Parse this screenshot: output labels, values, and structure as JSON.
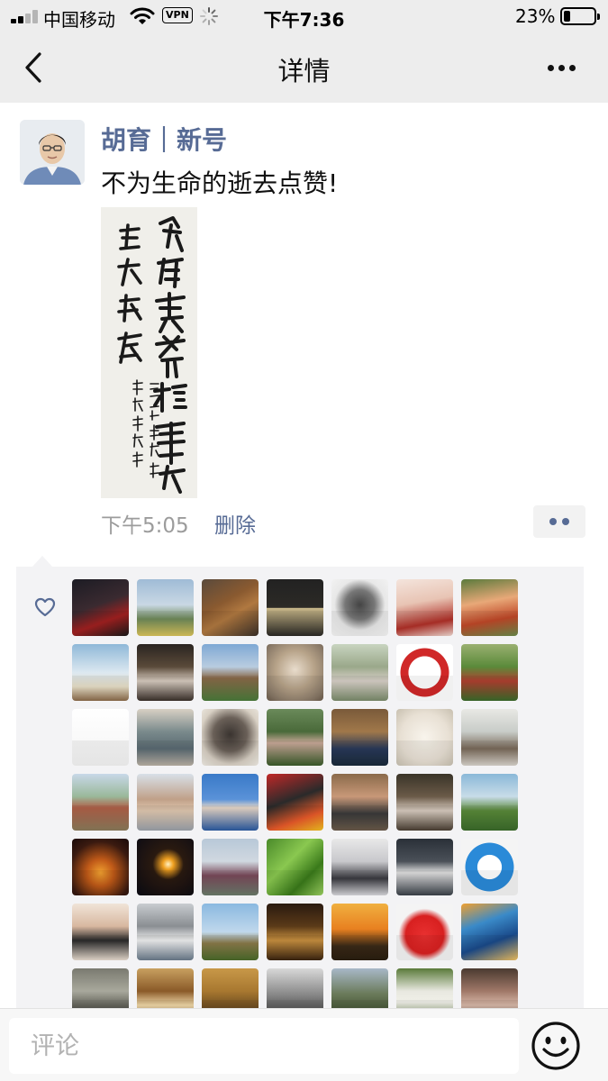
{
  "status_bar": {
    "carrier": "中国移动",
    "vpn_label": "VPN",
    "time": "下午7:36",
    "battery_percent": "23%",
    "battery_level": 0.23
  },
  "nav": {
    "title": "详情",
    "back_icon": "chevron-left-icon",
    "more_icon": "ellipsis-icon"
  },
  "post": {
    "author": "胡育｜新号",
    "text": "不为生命的逝去点赞!",
    "time": "下午5:05",
    "delete_label": "删除"
  },
  "likes": {
    "icon": "heart-outline-icon",
    "avatars": [
      {
        "bg": "linear-gradient(160deg,#1c1c24 0%,#3a2a30 45%,#a12020 70%,#1a1a1a 100%)"
      },
      {
        "bg": "linear-gradient(180deg,#9fbbd6 0%,#c9d8e4 45%,#6f8a5a 70%,#d8c35a 100%)"
      },
      {
        "bg": "linear-gradient(150deg,#5a4a3c 0%,#8a5a30 40%,#b07840 60%,#3b3028 100%)"
      },
      {
        "bg": "linear-gradient(180deg,#222 0%,#2c2a26 50%,#c9b88a 51%,#2a2824 100%)"
      },
      {
        "bg": "radial-gradient(circle at 50% 45%,#444 0%,#777 35%,#e8e8e8 60%,#f5f5f5 100%)"
      },
      {
        "bg": "linear-gradient(170deg,#f4e4dc 0%,#e8c4b4 40%,#b03028 75%,#f0d8d0 100%)"
      },
      {
        "bg": "linear-gradient(170deg,#5a7a3c 0%,#e8a878 40%,#c04828 70%,#6a8a4a 100%)"
      },
      {
        "bg": "linear-gradient(180deg,#8fb8d8 0%,#dce8f0 50%,#e8e0c8 75%,#8a6a4a 100%)"
      },
      {
        "bg": "linear-gradient(180deg,#2a2420 0%,#5a4a3a 40%,#d8ccc0 65%,#3a302a 100%)"
      },
      {
        "bg": "linear-gradient(180deg,#7fa8d4 0%,#b8cce0 40%,#8a6a4a 60%,#4a7a3a 100%)"
      },
      {
        "bg": "radial-gradient(circle at 50% 45%,#e8dccc 0%,#b8a48a 45%,#8a7a68 80%,#6a5a4a 100%)"
      },
      {
        "bg": "linear-gradient(180deg,#c8d4c0 0%,#9aa88a 40%,#d8d0c8 65%,#7a8a6a 100%)"
      },
      {
        "bg": "radial-gradient(circle at 50% 50%,#ffffff 0%,#ffffff 40%,#d02828 41%,#d02828 60%,#ffffff 61%,#ffffff 100%)"
      },
      {
        "bg": "linear-gradient(180deg,#9ab070 0%,#5a8a3a 40%,#b04030 65%,#3a6a2a 100%)"
      },
      {
        "bg": "linear-gradient(180deg,#ffffff 0%,#f4f4f4 100%)"
      },
      {
        "bg": "linear-gradient(180deg,#d8d0c4 0%,#7a8a8c 40%,#5a6a72 70%,#b8b0a4 100%)"
      },
      {
        "bg": "radial-gradient(circle at 50% 45%,#3a3430 0%,#6a6058 40%,#d8d0c4 70%,#f0ece4 100%)"
      },
      {
        "bg": "linear-gradient(180deg,#6a8a5a 0%,#4a6a3a 40%,#c8a898 60%,#3a5a2a 100%)"
      },
      {
        "bg": "linear-gradient(180deg,#7a5a3a 0%,#a0784a 40%,#2a3a5a 70%,#1a2a3a 100%)"
      },
      {
        "bg": "radial-gradient(circle at 50% 50%,#f8f4ec 0%,#e8e0d4 60%,#c8c0b0 100%)"
      },
      {
        "bg": "linear-gradient(180deg,#e8e8e4 0%,#c8ccc8 40%,#7a6a5a 70%,#d8d4cc 100%)"
      },
      {
        "bg": "linear-gradient(180deg,#c8d8e8 0%,#9ab89a 40%,#b06048 60%,#8a7a5a 100%)"
      },
      {
        "bg": "linear-gradient(180deg,#d8e0e8 0%,#c0a088 45%,#e0c8b0 65%,#9aa0a8 100%)"
      },
      {
        "bg": "linear-gradient(180deg,#3a7ac8 0%,#5a92d8 45%,#e8d8c8 60%,#2a5aa0 100%)"
      },
      {
        "bg": "linear-gradient(160deg,#c02828 0%,#2a2a2a 45%,#e85a2a 75%,#f0c020 100%)"
      },
      {
        "bg": "linear-gradient(180deg,#8a6a4a 0%,#c89878 40%,#3a3a3a 70%,#6a5a4a 100%)"
      },
      {
        "bg": "linear-gradient(180deg,#3a3428 0%,#6a5a48 40%,#d8ccc0 65%,#4a3e32 100%)"
      },
      {
        "bg": "linear-gradient(180deg,#8ab8d8 0%,#c8dce8 40%,#5a8a3a 65%,#3a6a2a 100%)"
      },
      {
        "bg": "radial-gradient(circle at 50% 60%,#f0a030 0%,#c05a18 30%,#3a1a10 70%,#1a0a08 100%)"
      },
      {
        "bg": "radial-gradient(circle at 55% 45%,#fff0c0 0%,#f0a020 12%,#2a1a10 35%,#0a0a14 100%)"
      },
      {
        "bg": "linear-gradient(180deg,#b8c8d8 0%,#d0d8e0 40%,#7a4a5a 65%,#6a7a6a 100%)"
      },
      {
        "bg": "linear-gradient(135deg,#4a8a2a 0%,#8ac850 40%,#3a7a1a 70%,#9ad060 100%)"
      },
      {
        "bg": "linear-gradient(180deg,#e8e8e8 0%,#c8c8cc 40%,#3a3a40 70%,#d8d8dc 100%)"
      },
      {
        "bg": "linear-gradient(180deg,#2a3038 0%,#4a5058 40%,#e0e0e0 60%,#3a4048 100%)"
      },
      {
        "bg": "radial-gradient(circle at 50% 50%,#ffffff 0%,#ffffff 30%,#2a8ad8 31%,#2a8ad8 60%,#f4f4f4 61%,#f4f4f4 100%)"
      },
      {
        "bg": "linear-gradient(180deg,#f0e4d8 0%,#d8b8a0 40%,#2a2a2a 65%,#e8dcd0 100%)"
      },
      {
        "bg": "linear-gradient(180deg,#c8ccd0 0%,#8a8e92 40%,#f0f0f0 65%,#6a7a8a 100%)"
      },
      {
        "bg": "linear-gradient(180deg,#8ab8e0 0%,#c0d8ec 50%,#8a7a4a 70%,#4a6a2a 100%)"
      },
      {
        "bg": "linear-gradient(180deg,#2a1a10 0%,#5a3a18 40%,#c89040 65%,#3a2410 100%)"
      },
      {
        "bg": "linear-gradient(180deg,#f0b040 0%,#e88020 45%,#3a2a18 75%,#2a1e10 100%)"
      },
      {
        "bg": "radial-gradient(circle at 50% 55%,#e83030 0%,#d82020 45%,#f4f4f4 62%,#f4f4f4 100%)"
      },
      {
        "bg": "linear-gradient(160deg,#f0a030 0%,#3a8ac8 35%,#1a4a8a 65%,#f0c060 100%)"
      },
      {
        "bg": "linear-gradient(180deg,#7a7a70 0%,#a8a89c 40%,#585850 70%,#9a9a90 100%)"
      },
      {
        "bg": "linear-gradient(180deg,#c8a060 0%,#8a5a28 40%,#f0d8a8 65%,#5a3a18 100%)"
      },
      {
        "bg": "linear-gradient(180deg,#c89848 0%,#a87830 40%,#6a4a20 70%,#3a2a18 100%)"
      },
      {
        "bg": "linear-gradient(180deg,#d8d8d8 0%,#8a8a8a 45%,#5a5a5a 70%,#b8b8b8 100%)"
      },
      {
        "bg": "linear-gradient(180deg,#a8b8c8 0%,#6a7a5a 45%,#4a5a3a 70%,#8a9a7a 100%)"
      },
      {
        "bg": "linear-gradient(180deg,#5a7a3a 0%,#e8e8e0 40%,#f0f0e8 60%,#4a6a2a 100%)"
      },
      {
        "bg": "linear-gradient(180deg,#4a3a30 0%,#a07868 40%,#d8b8a8 65%,#3a2a24 100%)"
      }
    ]
  },
  "comment_bar": {
    "placeholder": "评论",
    "emoji_icon": "smiley-face-icon"
  }
}
